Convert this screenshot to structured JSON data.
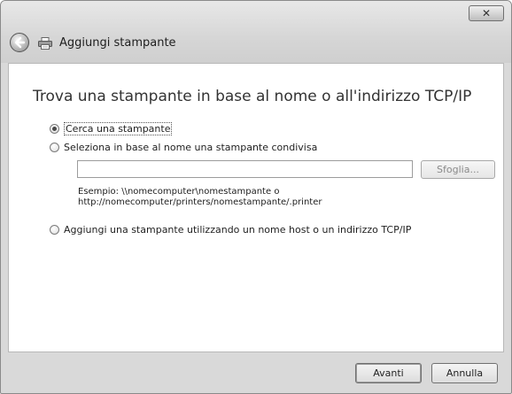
{
  "window": {
    "title": "Aggiungi stampante",
    "close_label": "✕"
  },
  "content": {
    "heading": "Trova una stampante in base al nome o all'indirizzo TCP/IP",
    "options": [
      {
        "label": "Cerca una stampante",
        "selected": true
      },
      {
        "label": "Seleziona in base al nome una stampante condivisa",
        "selected": false
      },
      {
        "label": "Aggiungi una stampante utilizzando un nome host o un indirizzo TCP/IP",
        "selected": false
      }
    ],
    "share_input": {
      "value": ""
    },
    "browse_label": "Sfoglia...",
    "example_line1": "Esempio: \\\\nomecomputer\\nomestampante o",
    "example_line2": "http://nomecomputer/printers/nomestampante/.printer"
  },
  "footer": {
    "next_label": "Avanti",
    "cancel_label": "Annulla"
  }
}
